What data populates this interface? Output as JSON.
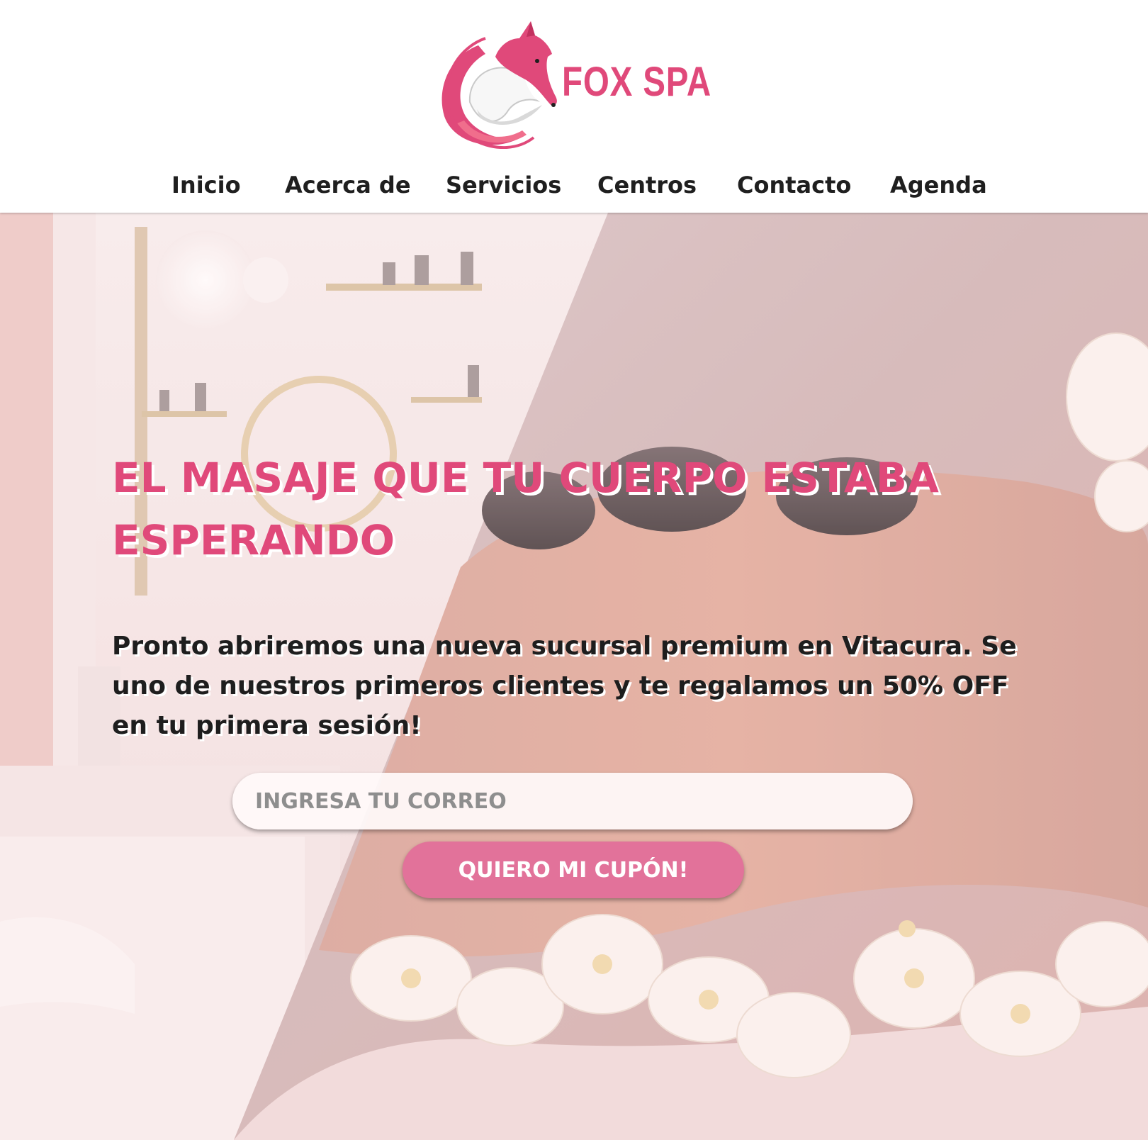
{
  "brand": {
    "name": "FOX SPA",
    "logo_icon": "fox-logo-icon",
    "primary_color": "#e0497a",
    "button_color": "#e2729a",
    "text_color": "#1f1f1f"
  },
  "nav": {
    "items": [
      {
        "label": "Inicio"
      },
      {
        "label": "Acerca de"
      },
      {
        "label": "Servicios"
      },
      {
        "label": "Centros"
      },
      {
        "label": "Contacto"
      },
      {
        "label": "Agenda"
      }
    ]
  },
  "hero": {
    "title": "EL MASAJE QUE TU CUERPO ESTABA ESPERANDO",
    "description": "Pronto abriremos una nueva sucursal premium en Vitacura. Se uno de nuestros primeros clientes y te regalamos un 50% OFF en tu primera sesión!",
    "email_placeholder": "INGRESA TU CORREO",
    "email_value": "",
    "cta_label": "QUIERO MI CUPÓN!"
  }
}
